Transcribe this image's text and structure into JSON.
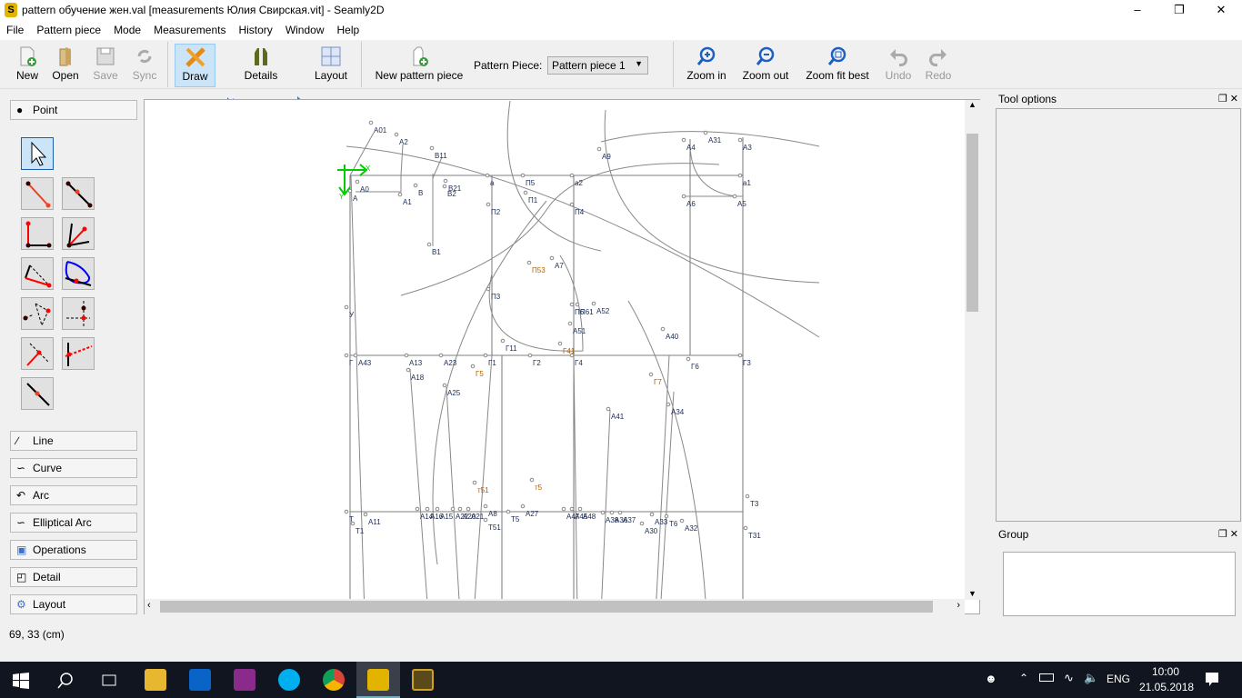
{
  "window": {
    "title": "pattern обучение жен.val [measurements Юлия Свирская.vit] - Seamly2D",
    "app_icon": "S"
  },
  "menu": [
    "File",
    "Pattern piece",
    "Mode",
    "Measurements",
    "History",
    "Window",
    "Help"
  ],
  "toolbar": {
    "new": "New",
    "open": "Open",
    "save": "Save",
    "sync": "Sync",
    "draw": "Draw",
    "details": "Details",
    "layout": "Layout",
    "new_piece": "New pattern piece",
    "piece_label": "Pattern Piece:",
    "piece_value": "Pattern piece 1",
    "zoom_in": "Zoom in",
    "zoom_out": "Zoom out",
    "zoom_fit": "Zoom fit best",
    "undo": "Undo",
    "redo": "Redo"
  },
  "left_panel": {
    "groups": [
      "Point",
      "Line",
      "Curve",
      "Arc",
      "Elliptical Arc",
      "Operations",
      "Detail",
      "Layout"
    ]
  },
  "canvas": {
    "axis_x": "X",
    "axis_y": "Y",
    "points": [
      "А01",
      "А2",
      "В11",
      "А0",
      "А",
      "А1",
      "В",
      "В21",
      "В2",
      "В1",
      "а",
      "П5",
      "а2",
      "П1",
      "П2",
      "П4",
      "А9",
      "А4",
      "А31",
      "А3",
      "а1",
      "А6",
      "А5",
      "П53",
      "А7",
      "П3",
      "П6",
      "П61",
      "А52",
      "А51",
      "У",
      "Г11",
      "Г41",
      "А40",
      "Г",
      "А43",
      "А13",
      "А23",
      "Г1",
      "Г2",
      "Г4",
      "Г3",
      "Г6",
      "Г5",
      "Г7",
      "А18",
      "А25",
      "А34",
      "А41",
      "т51",
      "т5",
      "Т",
      "А11",
      "А14",
      "А16",
      "А15",
      "А22",
      "А20",
      "А21",
      "А8",
      "Т5",
      "А27",
      "А47",
      "А45",
      "А48",
      "А38",
      "А36",
      "А37",
      "А33",
      "Т6",
      "А32",
      "А30",
      "Т1",
      "Т51",
      "Т3",
      "Т31"
    ]
  },
  "docks": {
    "tool_options": "Tool options",
    "group": "Group"
  },
  "status": "69, 33 (cm)",
  "taskbar": {
    "lang": "ENG",
    "time": "10:00",
    "date": "21.05.2018"
  }
}
